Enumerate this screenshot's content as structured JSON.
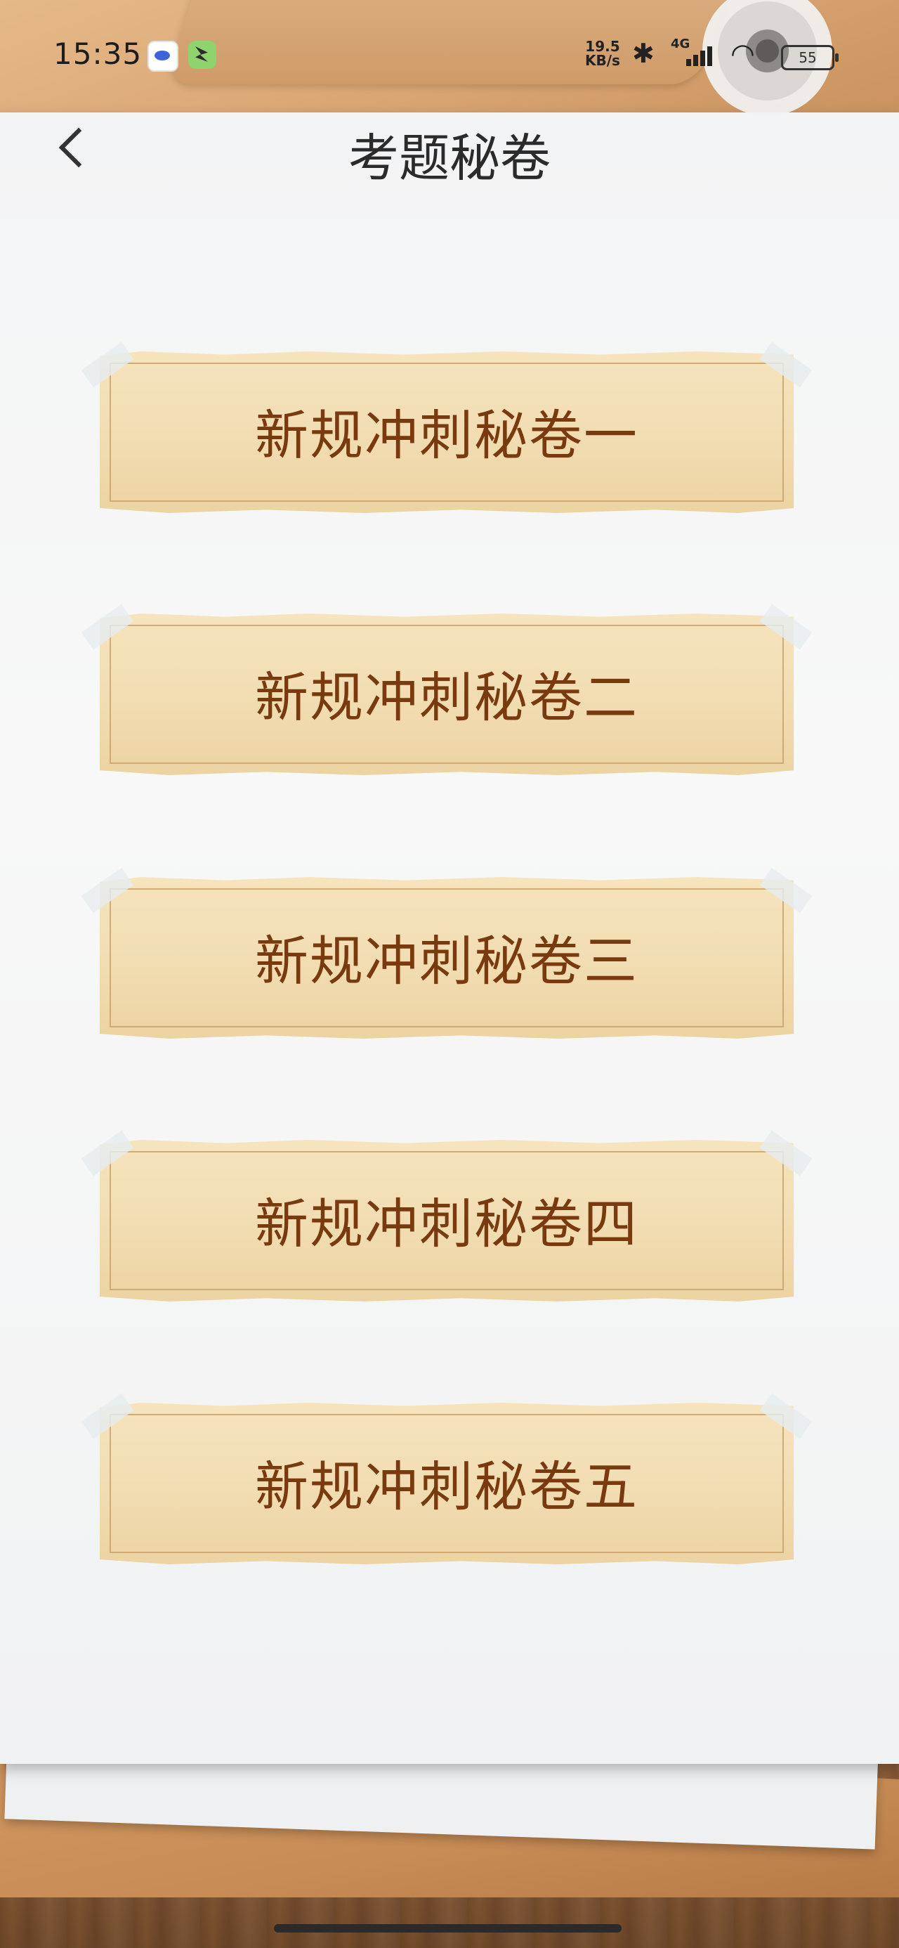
{
  "status_bar": {
    "time": "15:35",
    "net_speed_value": "19.5",
    "net_speed_unit": "KB/s",
    "network_type": "4G",
    "battery": "55"
  },
  "header": {
    "title": "考题秘卷"
  },
  "cards": [
    {
      "label": "新规冲刺秘卷一"
    },
    {
      "label": "新规冲刺秘卷二"
    },
    {
      "label": "新规冲刺秘卷三"
    },
    {
      "label": "新规冲刺秘卷四"
    },
    {
      "label": "新规冲刺秘卷五"
    }
  ],
  "colors": {
    "card_text": "#7a3a10",
    "card_fill": "#f2ddb3",
    "title_text": "#2b2b2b"
  }
}
